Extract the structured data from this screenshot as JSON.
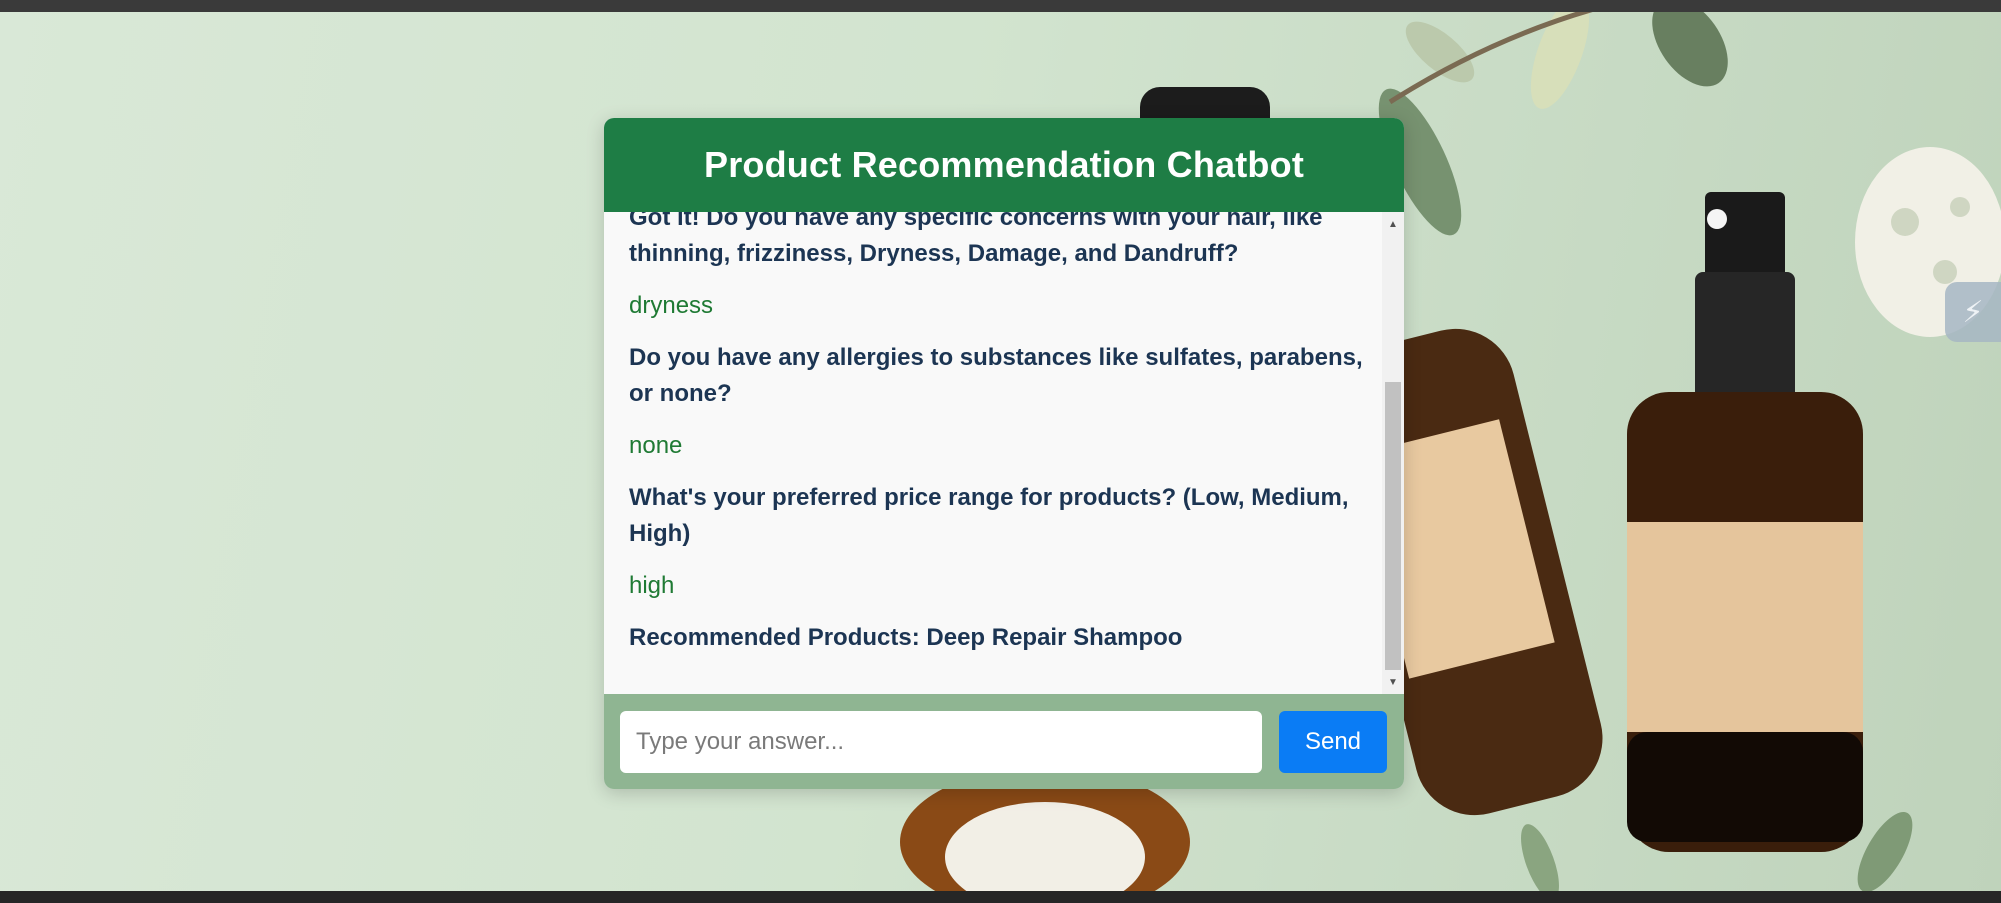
{
  "chat": {
    "title": "Product Recommendation Chatbot",
    "messages": [
      {
        "role": "bot",
        "text": "Got it! Do you have any specific concerns with your hair, like thinning, frizziness, Dryness, Damage, and Dandruff?"
      },
      {
        "role": "user",
        "text": "dryness"
      },
      {
        "role": "bot",
        "text": "Do you have any allergies to substances like sulfates, parabens, or none?"
      },
      {
        "role": "user",
        "text": "none"
      },
      {
        "role": "bot",
        "text": "What's your preferred price range for products? (Low, Medium, High)"
      },
      {
        "role": "user",
        "text": "high"
      },
      {
        "role": "bot",
        "text": "Recommended Products: Deep Repair Shampoo"
      }
    ],
    "input": {
      "placeholder": "Type your answer...",
      "value": ""
    },
    "send_label": "Send"
  },
  "colors": {
    "header": "#1e7d45",
    "bot_text": "#1c3553",
    "user_text": "#1f7a34",
    "footer": "#8fb592",
    "send_button": "#0a7cf5"
  },
  "icons": {
    "scroll_up": "triangle-up",
    "scroll_down": "triangle-down",
    "side_widget": "lightning-icon"
  }
}
